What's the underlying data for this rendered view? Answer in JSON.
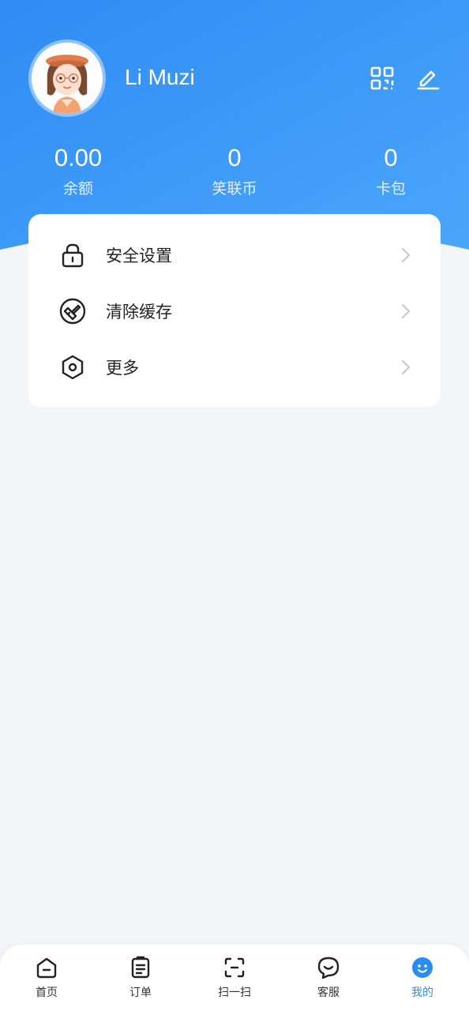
{
  "profile": {
    "username": "Li Muzi"
  },
  "header_icons": {
    "qr": "qr-code-icon",
    "edit": "edit-icon"
  },
  "stats": {
    "balance_value": "0.00",
    "balance_label": "余额",
    "coin_value": "0",
    "coin_label": "笑联币",
    "card_value": "0",
    "card_label": "卡包"
  },
  "menu": {
    "items": [
      {
        "label": "安全设置",
        "icon": "lock-icon"
      },
      {
        "label": "清除缓存",
        "icon": "broom-icon"
      },
      {
        "label": "更多",
        "icon": "hexagon-nut-icon"
      }
    ]
  },
  "tabbar": {
    "items": [
      {
        "label": "首页",
        "icon": "home-icon"
      },
      {
        "label": "订单",
        "icon": "clipboard-icon"
      },
      {
        "label": "扫一扫",
        "icon": "scan-icon"
      },
      {
        "label": "客服",
        "icon": "chat-icon"
      },
      {
        "label": "我的",
        "icon": "smiley-icon"
      }
    ],
    "active_index": 4
  },
  "colors": {
    "header_gradient_start": "#2f8cf3",
    "header_gradient_end": "#4aa6fb",
    "accent": "#2a8cf0",
    "page_background": "#f3f5f9"
  }
}
